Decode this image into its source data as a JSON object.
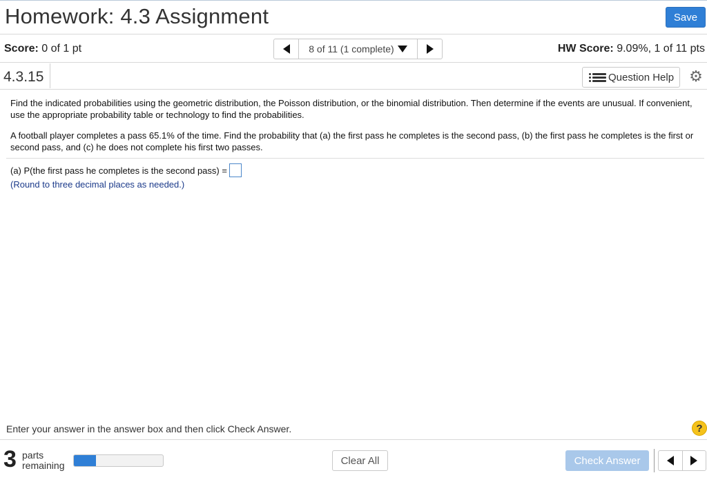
{
  "header": {
    "title": "Homework: 4.3 Assignment",
    "save_label": "Save"
  },
  "score_bar": {
    "score_label": "Score:",
    "score_value": "0 of 1 pt",
    "nav_label": "8 of 11 (1 complete)",
    "hw_score_label": "HW Score:",
    "hw_score_value": "9.09%, 1 of 11 pts"
  },
  "question_bar": {
    "question_id": "4.3.15",
    "help_label": "Question Help"
  },
  "question": {
    "instructions": "Find the indicated probabilities using the geometric distribution, the Poisson distribution, or the binomial distribution. Then determine if the events are unusual. If convenient, use the appropriate probability table or technology to find the probabilities.",
    "problem": "A football player completes a pass 65.1% of the time. Find the probability that (a) the first pass he completes is the second pass, (b) the first pass he completes is the first or second pass, and (c) he does not complete his first two passes.",
    "part_a_label": "(a) P(the first pass he completes is the second pass) =",
    "part_a_value": "",
    "round_note": "(Round to three decimal places as needed.)"
  },
  "footer": {
    "hint": "Enter your answer in the answer box and then click Check Answer.",
    "help_icon_glyph": "?",
    "parts_count": "3",
    "parts_line1": "parts",
    "parts_line2": "remaining",
    "progress_fraction": 0.25,
    "clear_label": "Clear All",
    "check_label": "Check Answer"
  },
  "colors": {
    "accent": "#2f7fd6",
    "check_disabled": "#a9c8ea",
    "note_blue": "#1b3a8a",
    "help_yellow": "#f5c21b"
  }
}
